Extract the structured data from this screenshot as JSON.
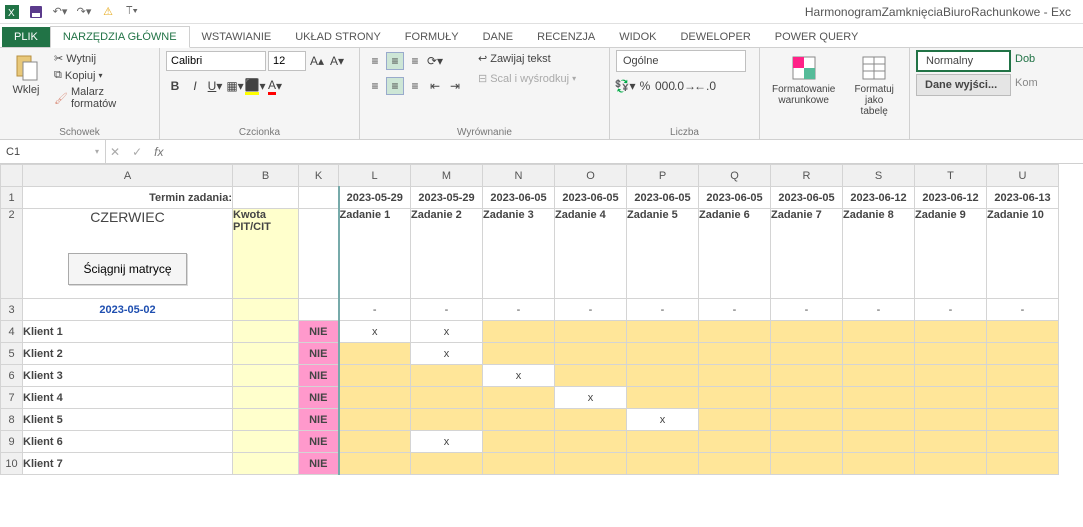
{
  "app_title": "HarmonogramZamknięciaBiuroRachunkowe - Exc",
  "tabs": {
    "file": "PLIK",
    "home": "NARZĘDZIA GŁÓWNE",
    "insert": "WSTAWIANIE",
    "layout": "UKŁAD STRONY",
    "formulas": "FORMUŁY",
    "data": "DANE",
    "review": "RECENZJA",
    "view": "WIDOK",
    "developer": "DEWELOPER",
    "powerquery": "POWER QUERY"
  },
  "ribbon": {
    "clipboard": {
      "label": "Schowek",
      "paste": "Wklej",
      "cut": "Wytnij",
      "copy": "Kopiuj",
      "format_painter": "Malarz formatów"
    },
    "font": {
      "label": "Czcionka",
      "name": "Calibri",
      "size": "12"
    },
    "alignment": {
      "label": "Wyrównanie",
      "wrap": "Zawijaj tekst",
      "merge": "Scal i wyśrodkuj"
    },
    "number": {
      "label": "Liczba",
      "format": "Ogólne"
    },
    "styles": {
      "cond": "Formatowanie warunkowe",
      "table": "Formatuj jako tabelę",
      "normal": "Normalny",
      "output": "Dane wyjści...",
      "dob": "Dob",
      "kom": "Kom"
    }
  },
  "namebox": "C1",
  "columns": [
    "A",
    "B",
    "K",
    "L",
    "M",
    "N",
    "O",
    "P",
    "Q",
    "R",
    "S",
    "T",
    "U"
  ],
  "row1": {
    "A": "Termin zadania:",
    "dates": [
      "2023-05-29",
      "2023-05-29",
      "2023-06-05",
      "2023-06-05",
      "2023-06-05",
      "2023-06-05",
      "2023-06-05",
      "2023-06-12",
      "2023-06-12",
      "2023-06-13"
    ]
  },
  "row2": {
    "month": "CZERWIEC",
    "button": "Ściągnij matrycę",
    "B": "Kwota PIT/CIT",
    "tasks": [
      "Zadanie 1",
      "Zadanie 2",
      "Zadanie 3",
      "Zadanie 4",
      "Zadanie 5",
      "Zadanie 6",
      "Zadanie 7",
      "Zadanie 8",
      "Zadanie 9",
      "Zadanie 10"
    ]
  },
  "row3": {
    "A": "2023-05-02",
    "dash": "-"
  },
  "K_val": "NIE",
  "x": "x",
  "clients": [
    "Klient 1",
    "Klient 2",
    "Klient 3",
    "Klient 4",
    "Klient 5",
    "Klient 6",
    "Klient 7"
  ],
  "chart_data": {
    "type": "table",
    "title": "Harmonogram zamknięcia — matryca zadań",
    "row_labels": [
      "Klient 1",
      "Klient 2",
      "Klient 3",
      "Klient 4",
      "Klient 5",
      "Klient 6",
      "Klient 7"
    ],
    "columns": [
      {
        "name": "Zadanie 1",
        "date": "2023-05-29"
      },
      {
        "name": "Zadanie 2",
        "date": "2023-05-29"
      },
      {
        "name": "Zadanie 3",
        "date": "2023-06-05"
      },
      {
        "name": "Zadanie 4",
        "date": "2023-06-05"
      },
      {
        "name": "Zadanie 5",
        "date": "2023-06-05"
      },
      {
        "name": "Zadanie 6",
        "date": "2023-06-05"
      },
      {
        "name": "Zadanie 7",
        "date": "2023-06-05"
      },
      {
        "name": "Zadanie 8",
        "date": "2023-06-12"
      },
      {
        "name": "Zadanie 9",
        "date": "2023-06-12"
      },
      {
        "name": "Zadanie 10",
        "date": "2023-06-13"
      }
    ],
    "status_column": {
      "name": "K",
      "values": [
        "NIE",
        "NIE",
        "NIE",
        "NIE",
        "NIE",
        "NIE",
        "NIE"
      ]
    },
    "marks": {
      "Klient 1": [
        "Zadanie 1",
        "Zadanie 2"
      ],
      "Klient 2": [
        "Zadanie 2"
      ],
      "Klient 3": [
        "Zadanie 3"
      ],
      "Klient 4": [
        "Zadanie 4"
      ],
      "Klient 5": [
        "Zadanie 5"
      ],
      "Klient 6": [
        "Zadanie 2"
      ],
      "Klient 7": []
    },
    "reference_date": "2023-05-02",
    "amount_column": "Kwota PIT/CIT"
  }
}
